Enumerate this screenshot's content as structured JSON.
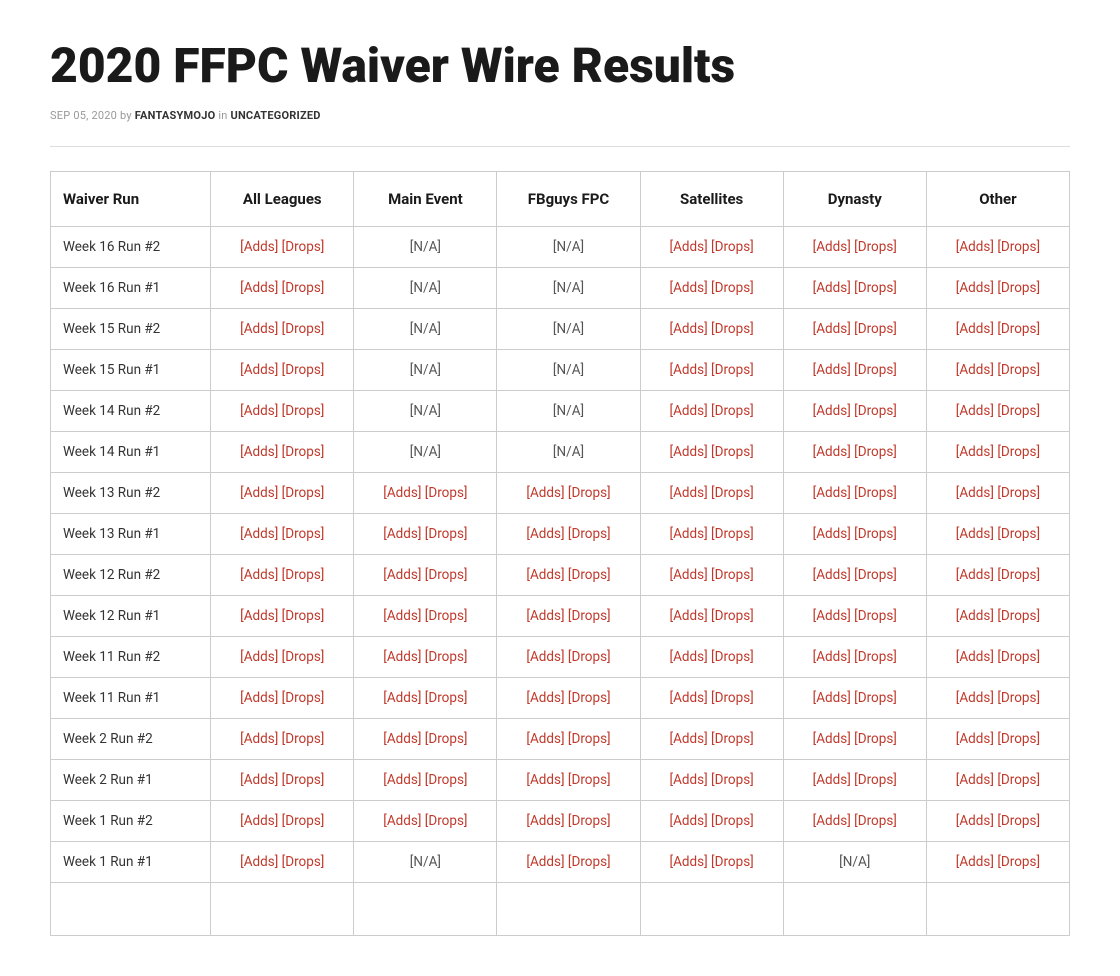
{
  "page": {
    "title": "2020 FFPC Waiver Wire Results",
    "meta": {
      "date": "SEP 05, 2020",
      "by": "by",
      "author": "FANTASYMOJO",
      "in": "in",
      "category": "UNCATEGORIZED"
    }
  },
  "table": {
    "headers": [
      "Waiver Run",
      "All Leagues",
      "Main Event",
      "FBguys FPC",
      "Satellites",
      "Dynasty",
      "Other"
    ],
    "rows": [
      {
        "run": "Week 16 Run #2",
        "all_leagues": {
          "adds": "[Adds]",
          "drops": "[Drops]"
        },
        "main_event": {
          "na": "[N/A]"
        },
        "fbguys": {
          "na": "[N/A]"
        },
        "satellites": {
          "adds": "[Adds]",
          "drops": "[Drops]"
        },
        "dynasty": {
          "adds": "[Adds]",
          "drops": "[Drops]"
        },
        "other": {
          "adds": "[Adds]",
          "drops": "[Drops]"
        }
      },
      {
        "run": "Week 16 Run #1",
        "all_leagues": {
          "adds": "[Adds]",
          "drops": "[Drops]"
        },
        "main_event": {
          "na": "[N/A]"
        },
        "fbguys": {
          "na": "[N/A]"
        },
        "satellites": {
          "adds": "[Adds]",
          "drops": "[Drops]"
        },
        "dynasty": {
          "adds": "[Adds]",
          "drops": "[Drops]"
        },
        "other": {
          "adds": "[Adds]",
          "drops": "[Drops]"
        }
      },
      {
        "run": "Week 15 Run #2",
        "all_leagues": {
          "adds": "[Adds]",
          "drops": "[Drops]"
        },
        "main_event": {
          "na": "[N/A]"
        },
        "fbguys": {
          "na": "[N/A]"
        },
        "satellites": {
          "adds": "[Adds]",
          "drops": "[Drops]"
        },
        "dynasty": {
          "adds": "[Adds]",
          "drops": "[Drops]"
        },
        "other": {
          "adds": "[Adds]",
          "drops": "[Drops]"
        }
      },
      {
        "run": "Week 15 Run #1",
        "all_leagues": {
          "adds": "[Adds]",
          "drops": "[Drops]"
        },
        "main_event": {
          "na": "[N/A]"
        },
        "fbguys": {
          "na": "[N/A]"
        },
        "satellites": {
          "adds": "[Adds]",
          "drops": "[Drops]"
        },
        "dynasty": {
          "adds": "[Adds]",
          "drops": "[Drops]"
        },
        "other": {
          "adds": "[Adds]",
          "drops": "[Drops]"
        }
      },
      {
        "run": "Week 14 Run #2",
        "all_leagues": {
          "adds": "[Adds]",
          "drops": "[Drops]"
        },
        "main_event": {
          "na": "[N/A]"
        },
        "fbguys": {
          "na": "[N/A]"
        },
        "satellites": {
          "adds": "[Adds]",
          "drops": "[Drops]"
        },
        "dynasty": {
          "adds": "[Adds]",
          "drops": "[Drops]"
        },
        "other": {
          "adds": "[Adds]",
          "drops": "[Drops]"
        }
      },
      {
        "run": "Week 14 Run #1",
        "all_leagues": {
          "adds": "[Adds]",
          "drops": "[Drops]"
        },
        "main_event": {
          "na": "[N/A]"
        },
        "fbguys": {
          "na": "[N/A]"
        },
        "satellites": {
          "adds": "[Adds]",
          "drops": "[Drops]"
        },
        "dynasty": {
          "adds": "[Adds]",
          "drops": "[Drops]"
        },
        "other": {
          "adds": "[Adds]",
          "drops": "[Drops]"
        }
      },
      {
        "run": "Week 13 Run #2",
        "all_leagues": {
          "adds": "[Adds]",
          "drops": "[Drops]"
        },
        "main_event": {
          "adds": "[Adds]",
          "drops": "[Drops]"
        },
        "fbguys": {
          "adds": "[Adds]",
          "drops": "[Drops]"
        },
        "satellites": {
          "adds": "[Adds]",
          "drops": "[Drops]"
        },
        "dynasty": {
          "adds": "[Adds]",
          "drops": "[Drops]"
        },
        "other": {
          "adds": "[Adds]",
          "drops": "[Drops]"
        }
      },
      {
        "run": "Week 13 Run #1",
        "all_leagues": {
          "adds": "[Adds]",
          "drops": "[Drops]"
        },
        "main_event": {
          "adds": "[Adds]",
          "drops": "[Drops]"
        },
        "fbguys": {
          "adds": "[Adds]",
          "drops": "[Drops]"
        },
        "satellites": {
          "adds": "[Adds]",
          "drops": "[Drops]"
        },
        "dynasty": {
          "adds": "[Adds]",
          "drops": "[Drops]"
        },
        "other": {
          "adds": "[Adds]",
          "drops": "[Drops]"
        }
      },
      {
        "run": "Week 12 Run #2",
        "all_leagues": {
          "adds": "[Adds]",
          "drops": "[Drops]"
        },
        "main_event": {
          "adds": "[Adds]",
          "drops": "[Drops]"
        },
        "fbguys": {
          "adds": "[Adds]",
          "drops": "[Drops]"
        },
        "satellites": {
          "adds": "[Adds]",
          "drops": "[Drops]"
        },
        "dynasty": {
          "adds": "[Adds]",
          "drops": "[Drops]"
        },
        "other": {
          "adds": "[Adds]",
          "drops": "[Drops]"
        }
      },
      {
        "run": "Week 12 Run #1",
        "all_leagues": {
          "adds": "[Adds]",
          "drops": "[Drops]"
        },
        "main_event": {
          "adds": "[Adds]",
          "drops": "[Drops]"
        },
        "fbguys": {
          "adds": "[Adds]",
          "drops": "[Drops]"
        },
        "satellites": {
          "adds": "[Adds]",
          "drops": "[Drops]"
        },
        "dynasty": {
          "adds": "[Adds]",
          "drops": "[Drops]"
        },
        "other": {
          "adds": "[Adds]",
          "drops": "[Drops]"
        }
      },
      {
        "run": "Week 11 Run #2",
        "all_leagues": {
          "adds": "[Adds]",
          "drops": "[Drops]"
        },
        "main_event": {
          "adds": "[Adds]",
          "drops": "[Drops]"
        },
        "fbguys": {
          "adds": "[Adds]",
          "drops": "[Drops]"
        },
        "satellites": {
          "adds": "[Adds]",
          "drops": "[Drops]"
        },
        "dynasty": {
          "adds": "[Adds]",
          "drops": "[Drops]"
        },
        "other": {
          "adds": "[Adds]",
          "drops": "[Drops]"
        }
      },
      {
        "run": "Week 11 Run #1",
        "all_leagues": {
          "adds": "[Adds]",
          "drops": "[Drops]"
        },
        "main_event": {
          "adds": "[Adds]",
          "drops": "[Drops]"
        },
        "fbguys": {
          "adds": "[Adds]",
          "drops": "[Drops]"
        },
        "satellites": {
          "adds": "[Adds]",
          "drops": "[Drops]"
        },
        "dynasty": {
          "adds": "[Adds]",
          "drops": "[Drops]"
        },
        "other": {
          "adds": "[Adds]",
          "drops": "[Drops]"
        }
      },
      {
        "run": "Week 2 Run #2",
        "all_leagues": {
          "adds": "[Adds]",
          "drops": "[Drops]"
        },
        "main_event": {
          "adds": "[Adds]",
          "drops": "[Drops]"
        },
        "fbguys": {
          "adds": "[Adds]",
          "drops": "[Drops]"
        },
        "satellites": {
          "adds": "[Adds]",
          "drops": "[Drops]"
        },
        "dynasty": {
          "adds": "[Adds]",
          "drops": "[Drops]"
        },
        "other": {
          "adds": "[Adds]",
          "drops": "[Drops]"
        }
      },
      {
        "run": "Week 2 Run #1",
        "all_leagues": {
          "adds": "[Adds]",
          "drops": "[Drops]"
        },
        "main_event": {
          "adds": "[Adds]",
          "drops": "[Drops]"
        },
        "fbguys": {
          "adds": "[Adds]",
          "drops": "[Drops]"
        },
        "satellites": {
          "adds": "[Adds]",
          "drops": "[Drops]"
        },
        "dynasty": {
          "adds": "[Adds]",
          "drops": "[Drops]"
        },
        "other": {
          "adds": "[Adds]",
          "drops": "[Drops]"
        }
      },
      {
        "run": "Week 1 Run #2",
        "all_leagues": {
          "adds": "[Adds]",
          "drops": "[Drops]"
        },
        "main_event": {
          "adds": "[Adds]",
          "drops": "[Drops]"
        },
        "fbguys": {
          "adds": "[Adds]",
          "drops": "[Drops]"
        },
        "satellites": {
          "adds": "[Adds]",
          "drops": "[Drops]"
        },
        "dynasty": {
          "adds": "[Adds]",
          "drops": "[Drops]"
        },
        "other": {
          "adds": "[Adds]",
          "drops": "[Drops]"
        }
      },
      {
        "run": "Week 1 Run #1",
        "all_leagues": {
          "adds": "[Adds]",
          "drops": "[Drops]"
        },
        "main_event": {
          "na": "[N/A]"
        },
        "fbguys": {
          "adds": "[Adds]",
          "drops": "[Drops]"
        },
        "satellites": {
          "adds": "[Adds]",
          "drops": "[Drops]"
        },
        "dynasty": {
          "na": "[N/A]"
        },
        "other": {
          "adds": "[Adds]",
          "drops": "[Drops]"
        }
      }
    ]
  }
}
